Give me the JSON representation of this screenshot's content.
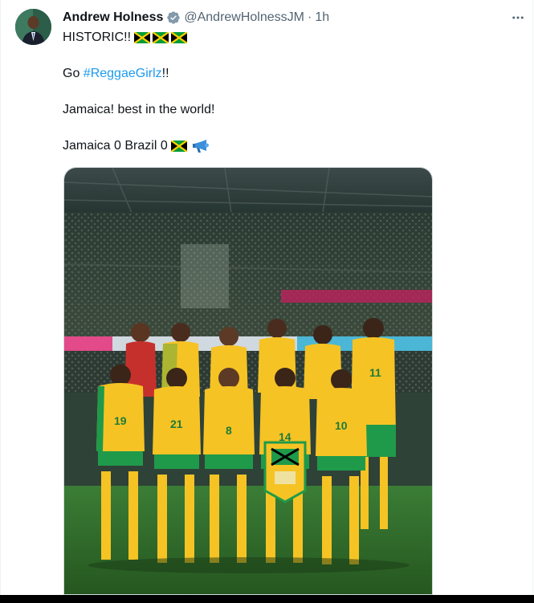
{
  "tweet": {
    "author_name": "Andrew Holness",
    "handle": "@AndrewHolnessJM",
    "separator": "·",
    "time": "1h",
    "line1_text": "HISTORIC!!",
    "line2_prefix": "Go ",
    "line2_hashtag": "#ReggaeGirlz",
    "line2_suffix": "!!",
    "line3_text": "Jamaica! best in the world!",
    "line4_text": "Jamaica 0 Brazil 0",
    "icons": [
      "jamaica-flag-icon",
      "megaphone-icon",
      "verified-badge-icon",
      "more-options-icon"
    ]
  },
  "media": {
    "jerseys": [
      "19",
      "21",
      "8",
      "14",
      "10",
      "11"
    ]
  },
  "colors": {
    "link": "#1d9bf0",
    "verified": "#829aab",
    "secondary_text": "#536471",
    "jersey_yellow": "#f6c324",
    "jersey_green": "#1f9a4a",
    "pitch": "#2f6e2c"
  }
}
